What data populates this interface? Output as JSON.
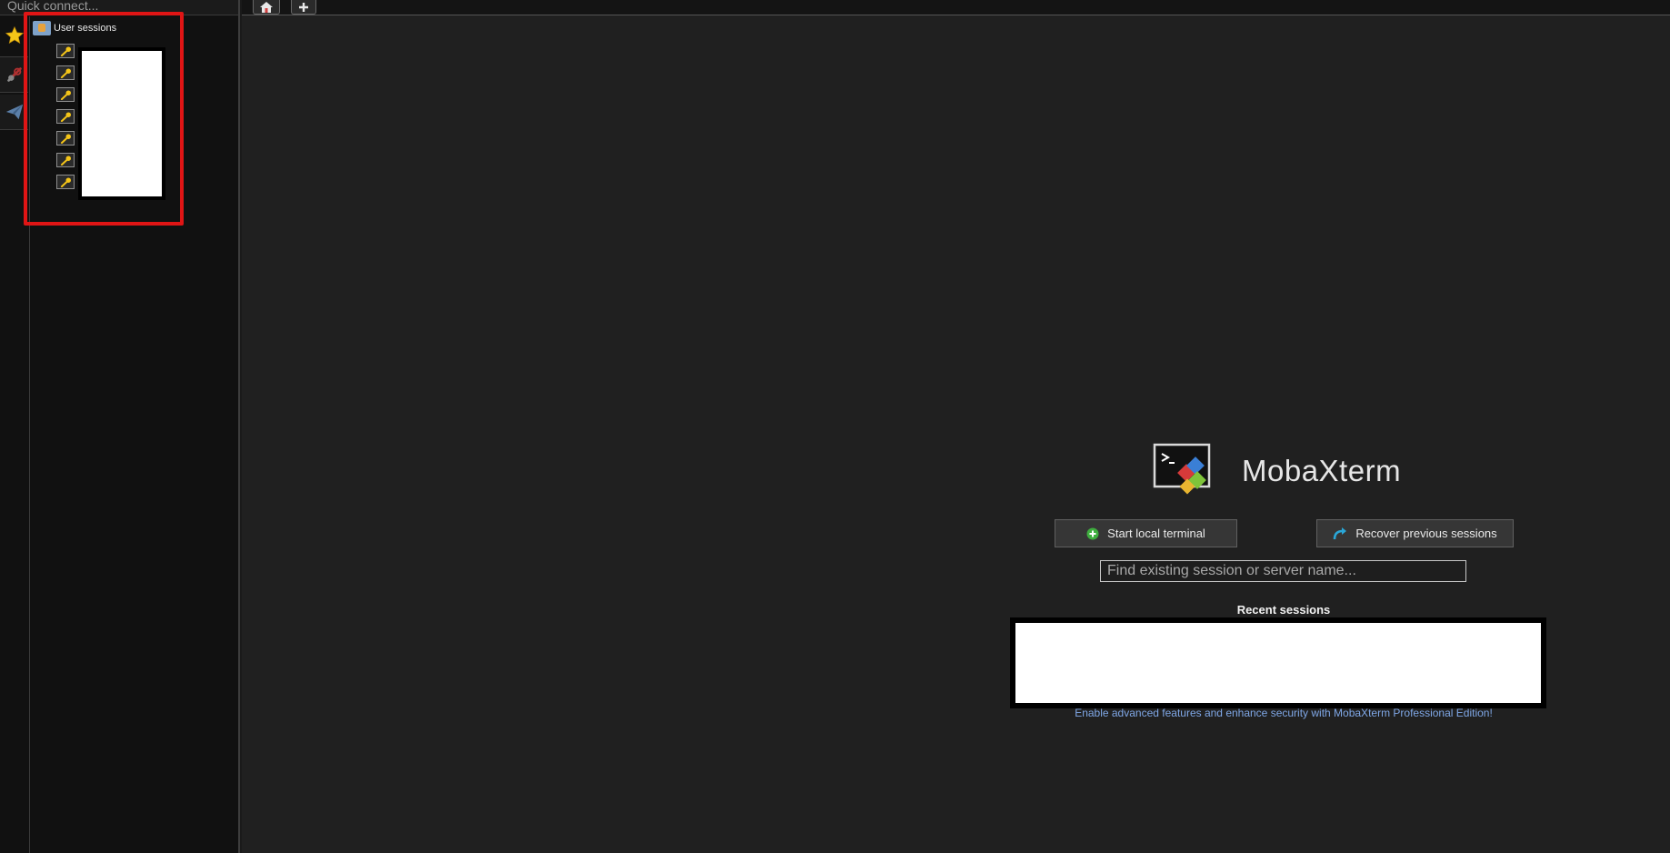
{
  "quick_connect": {
    "placeholder": "Quick connect..."
  },
  "sidebar": {
    "buttons": [
      {
        "name": "favorites",
        "icon": "star-icon"
      },
      {
        "name": "tools",
        "icon": "tools-icon"
      },
      {
        "name": "send",
        "icon": "paper-plane-icon"
      }
    ]
  },
  "sessions_tree": {
    "root_label": "User sessions",
    "root_icon": "user-folder-icon",
    "item_icon": "key-icon",
    "item_count": 7
  },
  "tabs": [
    {
      "name": "home",
      "icon": "home-icon"
    },
    {
      "name": "new-tab",
      "icon": "plus-icon"
    }
  ],
  "home": {
    "product_name": "MobaXterm",
    "start_local_terminal": "Start local terminal",
    "recover_previous_sessions": "Recover previous sessions",
    "search_placeholder": "Find existing session or server name...",
    "recent_sessions_title": "Recent sessions",
    "promo_text": "Enable advanced features and enhance security with MobaXterm Professional Edition!"
  },
  "colors": {
    "background": "#202020",
    "panel": "#111111",
    "highlight_box": "#e01515",
    "star": "#f5c518",
    "link": "#7fa7e6"
  }
}
